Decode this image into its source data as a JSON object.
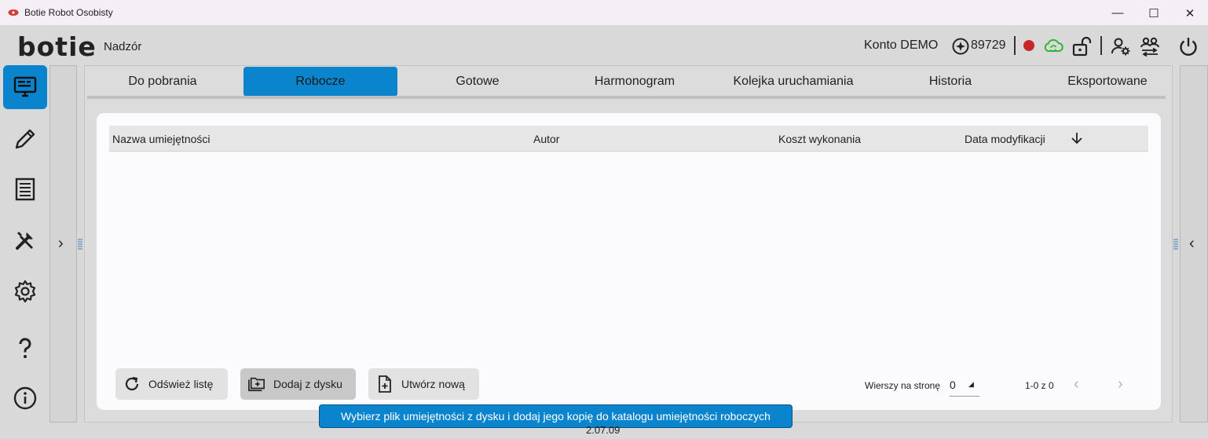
{
  "window": {
    "title": "Botie Robot Osobisty",
    "minimize": "—",
    "maximize": "☐",
    "close": "✕"
  },
  "header": {
    "logo": "botie",
    "section": "Nadzór",
    "account": "Konto DEMO",
    "coins": "89729",
    "icons": [
      "coin-icon",
      "recording-indicator",
      "cloud-sync-icon",
      "unlock-icon",
      "user-settings-icon",
      "users-transfer-icon",
      "power-icon"
    ],
    "colors": {
      "recording": "#c62828",
      "cloud": "#2eb82e"
    }
  },
  "nav": {
    "items": [
      "monitor-icon",
      "pencil-icon",
      "list-icon",
      "tools-icon",
      "gear-icon",
      "help-icon",
      "info-icon"
    ],
    "active": "monitor-icon",
    "accent": "#0a84cc"
  },
  "tabs": [
    {
      "label": "Do pobrania"
    },
    {
      "label": "Robocze",
      "active": true
    },
    {
      "label": "Gotowe"
    },
    {
      "label": "Harmonogram"
    },
    {
      "label": "Kolejka uruchamiania"
    },
    {
      "label": "Historia"
    },
    {
      "label": "Eksportowane"
    }
  ],
  "table": {
    "columns": [
      "Nazwa umiejętności",
      "Autor",
      "Koszt wykonania",
      "Data modyfikacji"
    ],
    "rows": []
  },
  "actions": {
    "refresh": "Odśwież listę",
    "add_from_disk": "Dodaj z dysku",
    "create_new": "Utwórz nową"
  },
  "pagination": {
    "rows_label": "Wierszy na stronę",
    "rows_value": "0",
    "range": "1-0 z 0"
  },
  "tooltip": "Wybierz plik umiejętności z dysku i dodaj jego kopię do katalogu umiejętności roboczych",
  "version": "2.07.09"
}
